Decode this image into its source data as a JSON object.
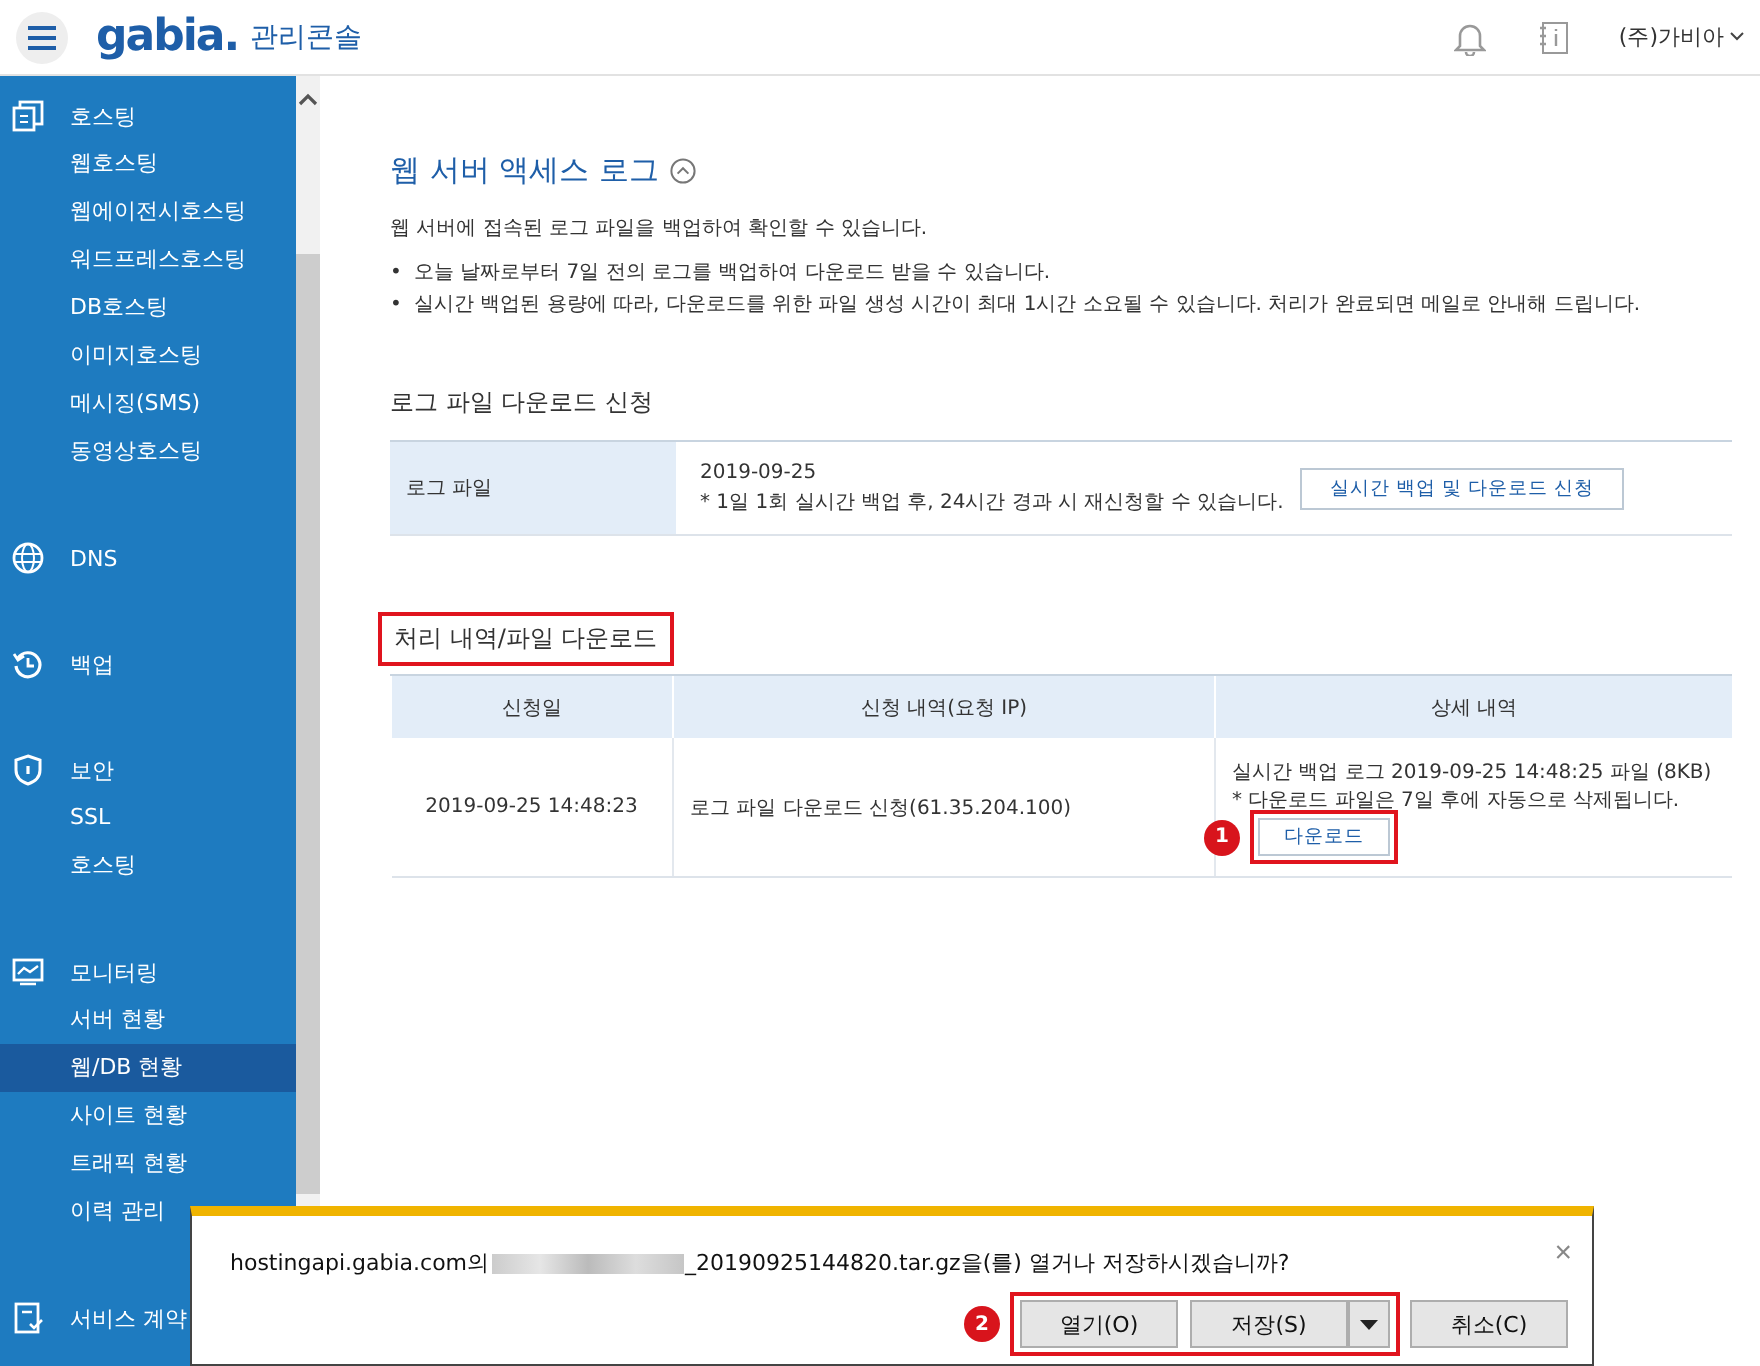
{
  "header": {
    "logo": "gabia.",
    "title": "관리콘솔",
    "account": "(주)가비아"
  },
  "sidebar": {
    "groups": [
      {
        "kind": "hosting",
        "title": "호스팅",
        "items": [
          {
            "label": "웹호스팅",
            "selected": false
          },
          {
            "label": "웹에이전시호스팅",
            "selected": false
          },
          {
            "label": "워드프레스호스팅",
            "selected": false
          },
          {
            "label": "DB호스팅",
            "selected": false
          },
          {
            "label": "이미지호스팅",
            "selected": false
          },
          {
            "label": "메시징(SMS)",
            "selected": false
          },
          {
            "label": "동영상호스팅",
            "selected": false
          }
        ]
      },
      {
        "kind": "globe",
        "title": "DNS"
      },
      {
        "kind": "backup",
        "title": "백업"
      },
      {
        "kind": "shield",
        "title": "보안",
        "items": [
          {
            "label": "SSL",
            "selected": false
          },
          {
            "label": "호스팅",
            "selected": false
          }
        ]
      },
      {
        "kind": "monitor",
        "title": "모니터링",
        "items": [
          {
            "label": "서버 현황",
            "selected": false
          },
          {
            "label": "웹/DB 현황",
            "selected": true
          },
          {
            "label": "사이트 현황",
            "selected": false
          },
          {
            "label": "트래픽 현황",
            "selected": false
          },
          {
            "label": "이력 관리",
            "selected": false
          }
        ]
      },
      {
        "kind": "contract",
        "title": "서비스 계약"
      }
    ]
  },
  "page": {
    "title": "웹 서버 액세스 로그",
    "intro": "웹 서버에 접속된 로그 파일을 백업하여 확인할 수 있습니다.",
    "notes": [
      {
        "bullet": "•",
        "text": "오늘 날짜로부터 7일 전의 로그를 백업하여 다운로드 받을 수 있습니다."
      },
      {
        "bullet": "•",
        "text": "실시간 백업된 용량에 따라, 다운로드를 위한 파일 생성 시간이 최대 1시간 소요될 수 있습니다. 처리가 완료되면 메일로 안내해 드립니다."
      }
    ]
  },
  "request_section": {
    "title": "로그 파일 다운로드 신청",
    "label": "로그 파일",
    "date": "2019-09-25",
    "note": "* 1일 1회 실시간 백업 후, 24시간 경과 시 재신청할 수 있습니다.",
    "button": "실시간 백업 및 다운로드 신청"
  },
  "history_section": {
    "title": "처리 내역/파일 다운로드",
    "highlighted": true,
    "columns": [
      "신청일",
      "신청 내역(요청 IP)",
      "상세 내역"
    ],
    "rows": [
      {
        "date": "2019-09-25 14:48:23",
        "request": "로그 파일 다운로드 신청(61.35.204.100)",
        "detail": "실시간 백업 로그 2019-09-25 14:48:25 파일 (8KB)",
        "detail_note": "* 다운로드 파일은 7일 후에 자동으로 삭제됩니다.",
        "button": "다운로드",
        "marker": "1",
        "highlighted": true
      }
    ]
  },
  "download_dialog": {
    "message_start": "hostingapi.gabia.com의",
    "message_end": "_20190925144820.tar.gz을(를) 열거나 저장하시겠습니까?",
    "close": "×",
    "marker": "2",
    "highlighted": true,
    "buttons": [
      {
        "label": "열기(O)",
        "kind": "plain"
      },
      {
        "label": "저장(S)",
        "kind": "split"
      },
      {
        "label": "취소(C)",
        "kind": "plain"
      }
    ]
  }
}
